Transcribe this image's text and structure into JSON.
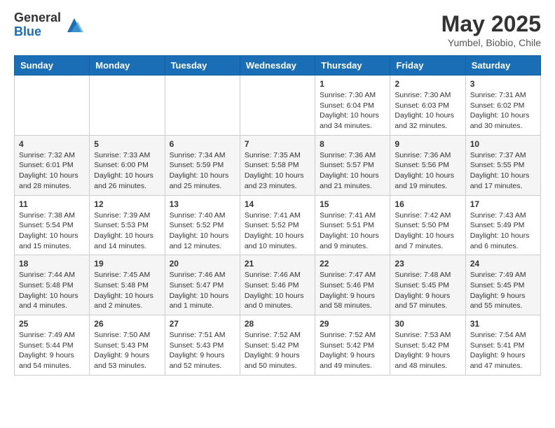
{
  "logo": {
    "general": "General",
    "blue": "Blue"
  },
  "title": "May 2025",
  "subtitle": "Yumbel, Biobio, Chile",
  "weekdays": [
    "Sunday",
    "Monday",
    "Tuesday",
    "Wednesday",
    "Thursday",
    "Friday",
    "Saturday"
  ],
  "weeks": [
    [
      {
        "day": "",
        "info": ""
      },
      {
        "day": "",
        "info": ""
      },
      {
        "day": "",
        "info": ""
      },
      {
        "day": "",
        "info": ""
      },
      {
        "day": "1",
        "info": "Sunrise: 7:30 AM\nSunset: 6:04 PM\nDaylight: 10 hours\nand 34 minutes."
      },
      {
        "day": "2",
        "info": "Sunrise: 7:30 AM\nSunset: 6:03 PM\nDaylight: 10 hours\nand 32 minutes."
      },
      {
        "day": "3",
        "info": "Sunrise: 7:31 AM\nSunset: 6:02 PM\nDaylight: 10 hours\nand 30 minutes."
      }
    ],
    [
      {
        "day": "4",
        "info": "Sunrise: 7:32 AM\nSunset: 6:01 PM\nDaylight: 10 hours\nand 28 minutes."
      },
      {
        "day": "5",
        "info": "Sunrise: 7:33 AM\nSunset: 6:00 PM\nDaylight: 10 hours\nand 26 minutes."
      },
      {
        "day": "6",
        "info": "Sunrise: 7:34 AM\nSunset: 5:59 PM\nDaylight: 10 hours\nand 25 minutes."
      },
      {
        "day": "7",
        "info": "Sunrise: 7:35 AM\nSunset: 5:58 PM\nDaylight: 10 hours\nand 23 minutes."
      },
      {
        "day": "8",
        "info": "Sunrise: 7:36 AM\nSunset: 5:57 PM\nDaylight: 10 hours\nand 21 minutes."
      },
      {
        "day": "9",
        "info": "Sunrise: 7:36 AM\nSunset: 5:56 PM\nDaylight: 10 hours\nand 19 minutes."
      },
      {
        "day": "10",
        "info": "Sunrise: 7:37 AM\nSunset: 5:55 PM\nDaylight: 10 hours\nand 17 minutes."
      }
    ],
    [
      {
        "day": "11",
        "info": "Sunrise: 7:38 AM\nSunset: 5:54 PM\nDaylight: 10 hours\nand 15 minutes."
      },
      {
        "day": "12",
        "info": "Sunrise: 7:39 AM\nSunset: 5:53 PM\nDaylight: 10 hours\nand 14 minutes."
      },
      {
        "day": "13",
        "info": "Sunrise: 7:40 AM\nSunset: 5:52 PM\nDaylight: 10 hours\nand 12 minutes."
      },
      {
        "day": "14",
        "info": "Sunrise: 7:41 AM\nSunset: 5:52 PM\nDaylight: 10 hours\nand 10 minutes."
      },
      {
        "day": "15",
        "info": "Sunrise: 7:41 AM\nSunset: 5:51 PM\nDaylight: 10 hours\nand 9 minutes."
      },
      {
        "day": "16",
        "info": "Sunrise: 7:42 AM\nSunset: 5:50 PM\nDaylight: 10 hours\nand 7 minutes."
      },
      {
        "day": "17",
        "info": "Sunrise: 7:43 AM\nSunset: 5:49 PM\nDaylight: 10 hours\nand 6 minutes."
      }
    ],
    [
      {
        "day": "18",
        "info": "Sunrise: 7:44 AM\nSunset: 5:48 PM\nDaylight: 10 hours\nand 4 minutes."
      },
      {
        "day": "19",
        "info": "Sunrise: 7:45 AM\nSunset: 5:48 PM\nDaylight: 10 hours\nand 2 minutes."
      },
      {
        "day": "20",
        "info": "Sunrise: 7:46 AM\nSunset: 5:47 PM\nDaylight: 10 hours\nand 1 minute."
      },
      {
        "day": "21",
        "info": "Sunrise: 7:46 AM\nSunset: 5:46 PM\nDaylight: 10 hours\nand 0 minutes."
      },
      {
        "day": "22",
        "info": "Sunrise: 7:47 AM\nSunset: 5:46 PM\nDaylight: 9 hours\nand 58 minutes."
      },
      {
        "day": "23",
        "info": "Sunrise: 7:48 AM\nSunset: 5:45 PM\nDaylight: 9 hours\nand 57 minutes."
      },
      {
        "day": "24",
        "info": "Sunrise: 7:49 AM\nSunset: 5:45 PM\nDaylight: 9 hours\nand 55 minutes."
      }
    ],
    [
      {
        "day": "25",
        "info": "Sunrise: 7:49 AM\nSunset: 5:44 PM\nDaylight: 9 hours\nand 54 minutes."
      },
      {
        "day": "26",
        "info": "Sunrise: 7:50 AM\nSunset: 5:43 PM\nDaylight: 9 hours\nand 53 minutes."
      },
      {
        "day": "27",
        "info": "Sunrise: 7:51 AM\nSunset: 5:43 PM\nDaylight: 9 hours\nand 52 minutes."
      },
      {
        "day": "28",
        "info": "Sunrise: 7:52 AM\nSunset: 5:42 PM\nDaylight: 9 hours\nand 50 minutes."
      },
      {
        "day": "29",
        "info": "Sunrise: 7:52 AM\nSunset: 5:42 PM\nDaylight: 9 hours\nand 49 minutes."
      },
      {
        "day": "30",
        "info": "Sunrise: 7:53 AM\nSunset: 5:42 PM\nDaylight: 9 hours\nand 48 minutes."
      },
      {
        "day": "31",
        "info": "Sunrise: 7:54 AM\nSunset: 5:41 PM\nDaylight: 9 hours\nand 47 minutes."
      }
    ]
  ]
}
